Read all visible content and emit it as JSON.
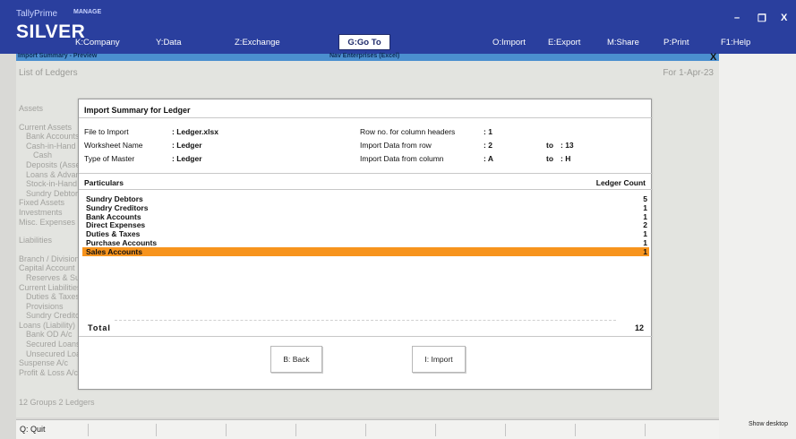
{
  "app": {
    "brand_small": "TallyPrime",
    "brand_big": "SILVER",
    "manage": "MANAGE"
  },
  "menu": {
    "company": "K:Company",
    "data": "Y:Data",
    "exchange": "Z:Exchange",
    "goto": "G:Go To",
    "import": "O:Import",
    "export": "E:Export",
    "share": "M:Share",
    "print": "P:Print",
    "help": "F1:Help"
  },
  "window_controls": {
    "minimize": "–",
    "restore": "❐",
    "close": "X"
  },
  "strip": {
    "left": "Import Summary - Preview",
    "center": "Nav Enterprises (Excel)",
    "close": "X"
  },
  "background": {
    "title": "List of Ledgers",
    "period": "For 1-Apr-23",
    "items": [
      {
        "label": "Assets",
        "level": 0,
        "gap": false
      },
      {
        "label": "Current Assets",
        "level": 0,
        "gap": true
      },
      {
        "label": "Bank Accounts",
        "level": 1,
        "gap": false
      },
      {
        "label": "Cash-in-Hand",
        "level": 1,
        "gap": false
      },
      {
        "label": "Cash",
        "level": 2,
        "gap": false
      },
      {
        "label": "Deposits (Asset)",
        "level": 1,
        "gap": false
      },
      {
        "label": "Loans & Advances",
        "level": 1,
        "gap": false
      },
      {
        "label": "Stock-in-Hand",
        "level": 1,
        "gap": false
      },
      {
        "label": "Sundry Debtors",
        "level": 1,
        "gap": false
      },
      {
        "label": "Fixed Assets",
        "level": 0,
        "gap": false
      },
      {
        "label": "Investments",
        "level": 0,
        "gap": false
      },
      {
        "label": "Misc. Expenses",
        "level": 0,
        "gap": false
      },
      {
        "label": "Liabilities",
        "level": 0,
        "gap": true
      },
      {
        "label": "Branch / Divisions",
        "level": 0,
        "gap": true
      },
      {
        "label": "Capital Account",
        "level": 0,
        "gap": false
      },
      {
        "label": "Reserves & Surplus",
        "level": 1,
        "gap": false
      },
      {
        "label": "Current Liabilities",
        "level": 0,
        "gap": false
      },
      {
        "label": "Duties & Taxes",
        "level": 1,
        "gap": false
      },
      {
        "label": "Provisions",
        "level": 1,
        "gap": false
      },
      {
        "label": "Sundry Creditors",
        "level": 1,
        "gap": false
      },
      {
        "label": "Loans (Liability)",
        "level": 0,
        "gap": false
      },
      {
        "label": "Bank OD A/c",
        "level": 1,
        "gap": false
      },
      {
        "label": "Secured Loans",
        "level": 1,
        "gap": false
      },
      {
        "label": "Unsecured Loans",
        "level": 1,
        "gap": false
      },
      {
        "label": "Suspense A/c",
        "level": 0,
        "gap": false
      },
      {
        "label": "Profit & Loss A/c",
        "level": 0,
        "gap": false
      }
    ],
    "footer": "12 Groups   2 Ledgers"
  },
  "modal": {
    "title": "Import Summary for Ledger",
    "file_label": "File to Import",
    "file_value": ": Ledger.xlsx",
    "sheet_label": "Worksheet Name",
    "sheet_value": ": Ledger",
    "master_label": "Type of Master",
    "master_value": ": Ledger",
    "header_row_label": "Row no. for column headers",
    "header_row_value": ": 1",
    "data_row_label": "Import Data from row",
    "data_row_from": ": 2",
    "data_row_to_label": "to",
    "data_row_to": ": 13",
    "data_col_label": "Import Data from column",
    "data_col_from": ": A",
    "data_col_to_label": "to",
    "data_col_to": ": H",
    "col_particulars": "Particulars",
    "col_count": "Ledger Count",
    "rows": [
      {
        "particular": "Sundry Debtors",
        "count": "5",
        "selected": false
      },
      {
        "particular": "Sundry Creditors",
        "count": "1",
        "selected": false
      },
      {
        "particular": "Bank Accounts",
        "count": "1",
        "selected": false
      },
      {
        "particular": "Direct Expenses",
        "count": "2",
        "selected": false
      },
      {
        "particular": "Duties & Taxes",
        "count": "1",
        "selected": false
      },
      {
        "particular": "Purchase Accounts",
        "count": "1",
        "selected": false
      },
      {
        "particular": "Sales Accounts",
        "count": "1",
        "selected": true
      }
    ],
    "total_label": "Total",
    "total_value": "12",
    "back_button": "B: Back",
    "import_button": "I: Import"
  },
  "bottom": {
    "quit": "Q: Quit",
    "show_desktop": "Show desktop"
  },
  "colors": {
    "topbar": "#2a3f9e",
    "strip": "#4b8fcf",
    "selected_row": "#f7941d"
  }
}
